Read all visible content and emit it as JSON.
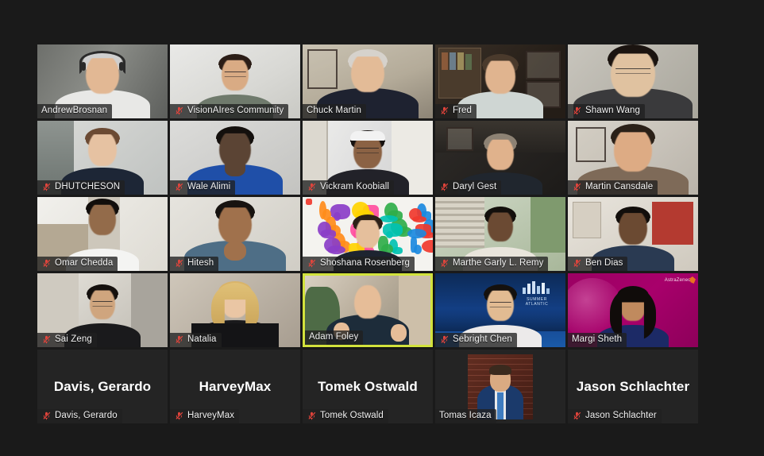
{
  "app": {
    "name": "Zoom Meeting",
    "view": "gallery-view",
    "background_color": "#1a1a1a",
    "active_speaker_border_color": "#d2e23c",
    "mic_muted_color": "#e8453c",
    "grid_columns": 5,
    "grid_rows": 5
  },
  "participants": [
    {
      "name": "AndrewBrosnan",
      "muted": false,
      "active_speaker": false,
      "type": "video",
      "row": 1,
      "col": 1
    },
    {
      "name": "VisionAIres Community",
      "muted": true,
      "active_speaker": false,
      "type": "video",
      "row": 1,
      "col": 2
    },
    {
      "name": "Chuck Martin",
      "muted": false,
      "active_speaker": false,
      "type": "video",
      "row": 1,
      "col": 3
    },
    {
      "name": "Fred",
      "muted": true,
      "active_speaker": false,
      "type": "video",
      "row": 1,
      "col": 4
    },
    {
      "name": "Shawn Wang",
      "muted": true,
      "active_speaker": false,
      "type": "video",
      "row": 1,
      "col": 5
    },
    {
      "name": "DHUTCHESON",
      "muted": true,
      "active_speaker": false,
      "type": "video",
      "row": 2,
      "col": 1
    },
    {
      "name": "Wale Alimi",
      "muted": true,
      "active_speaker": false,
      "type": "video",
      "row": 2,
      "col": 2
    },
    {
      "name": "Vickram Koobiall",
      "muted": true,
      "active_speaker": false,
      "type": "video",
      "row": 2,
      "col": 3
    },
    {
      "name": "Daryl Gest",
      "muted": true,
      "active_speaker": false,
      "type": "video",
      "row": 2,
      "col": 4
    },
    {
      "name": "Martin Cansdale",
      "muted": true,
      "active_speaker": false,
      "type": "video",
      "row": 2,
      "col": 5
    },
    {
      "name": "Omar Chedda",
      "muted": true,
      "active_speaker": false,
      "type": "video",
      "row": 3,
      "col": 1
    },
    {
      "name": "Hitesh",
      "muted": true,
      "active_speaker": false,
      "type": "video",
      "row": 3,
      "col": 2
    },
    {
      "name": "Shoshana Rosenberg",
      "muted": true,
      "active_speaker": false,
      "type": "video",
      "row": 3,
      "col": 3
    },
    {
      "name": "Marthe Garly L. Remy",
      "muted": true,
      "active_speaker": false,
      "type": "video",
      "row": 3,
      "col": 4
    },
    {
      "name": "Ben Dias",
      "muted": true,
      "active_speaker": false,
      "type": "video",
      "row": 3,
      "col": 5
    },
    {
      "name": "Sai Zeng",
      "muted": true,
      "active_speaker": false,
      "type": "video",
      "row": 4,
      "col": 1
    },
    {
      "name": "Natalia",
      "muted": true,
      "active_speaker": false,
      "type": "video",
      "row": 4,
      "col": 2
    },
    {
      "name": "Adam Foley",
      "muted": false,
      "active_speaker": true,
      "type": "video",
      "row": 4,
      "col": 3
    },
    {
      "name": "Sebright Chen",
      "muted": true,
      "active_speaker": false,
      "type": "video",
      "row": 4,
      "col": 4
    },
    {
      "name": "Margi Sheth",
      "muted": false,
      "active_speaker": false,
      "type": "video",
      "row": 4,
      "col": 5
    },
    {
      "name": "Davis, Gerardo",
      "muted": true,
      "active_speaker": false,
      "type": "name-only",
      "row": 5,
      "col": 1,
      "display_name": "Davis, Gerardo"
    },
    {
      "name": "HarveyMax",
      "muted": true,
      "active_speaker": false,
      "type": "name-only",
      "row": 5,
      "col": 2,
      "display_name": "HarveyMax"
    },
    {
      "name": "Tomek Ostwald",
      "muted": true,
      "active_speaker": false,
      "type": "name-only",
      "row": 5,
      "col": 3,
      "display_name": "Tomek Ostwald"
    },
    {
      "name": "Tomas Icaza",
      "muted": false,
      "active_speaker": false,
      "type": "avatar-photo",
      "row": 5,
      "col": 4
    },
    {
      "name": "Jason Schlachter",
      "muted": true,
      "active_speaker": false,
      "type": "name-only",
      "row": 5,
      "col": 5,
      "display_name": "Jason Schlachter"
    }
  ],
  "virtual_backgrounds": {
    "sebright_chen_logo": "SUMMER ATLANTIC",
    "margi_sheth_logo": "AstraZeneca"
  }
}
